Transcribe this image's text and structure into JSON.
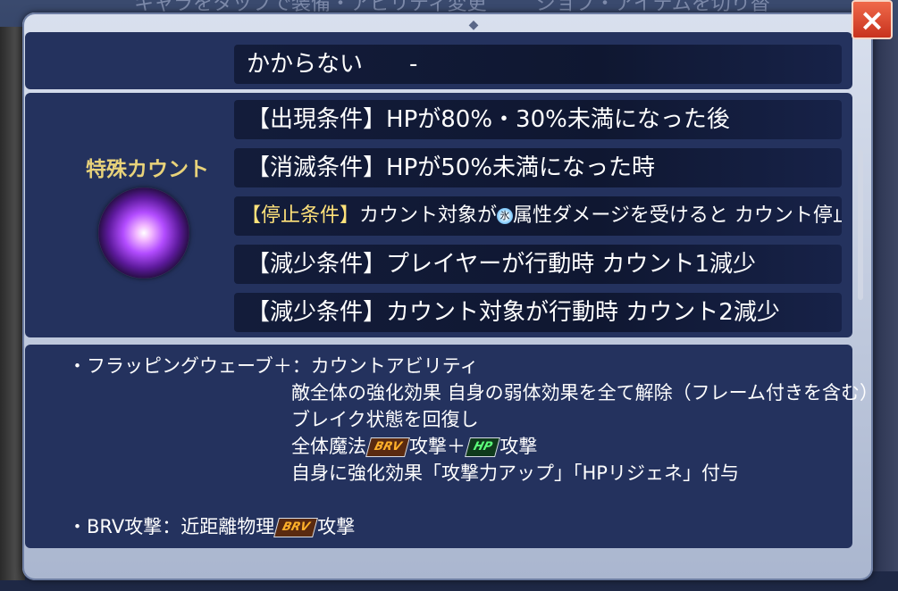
{
  "background": {
    "top_text_left": "キャラをタップで装備・アビリティ変更",
    "top_text_right": "ジョブ・アイテムを切り替"
  },
  "close_button": {
    "label": "×"
  },
  "status_row": {
    "text": "かからない　　-"
  },
  "special_count": {
    "label": "特殊カウント",
    "conditions": [
      {
        "tag": "【出現条件】",
        "text": "HPが80%・30%未満になった後"
      },
      {
        "tag": "【消滅条件】",
        "text": "HPが50%未満になった時"
      },
      {
        "tag": "【停止条件】",
        "text_before": "カウント対象が",
        "element_icon": "氷",
        "text_after": "属性ダメージを受けると カウント停止"
      },
      {
        "tag": "【減少条件】",
        "text": "プレイヤーが行動時 カウント1減少"
      },
      {
        "tag": "【減少条件】",
        "text": "カウント対象が行動時 カウント2減少"
      }
    ]
  },
  "description": {
    "ability_name": "・フラッピングウェーブ＋：",
    "ability_type": "カウントアビリティ",
    "line2": "敵全体の強化効果 自身の弱体効果を全て解除（フレーム付きを含む）",
    "line3": "ブレイク状態を回復し",
    "line4_a": "全体魔法",
    "line4_tag1": "BRV",
    "line4_b": "攻撃＋",
    "line4_tag2": "HP",
    "line4_c": "攻撃",
    "line5": "自身に強化効果「攻撃力アップ」「HPリジェネ」付与",
    "brv_attack_a": "・BRV攻撃：近距離物理",
    "brv_attack_tag": "BRV",
    "brv_attack_b": "攻撃"
  }
}
